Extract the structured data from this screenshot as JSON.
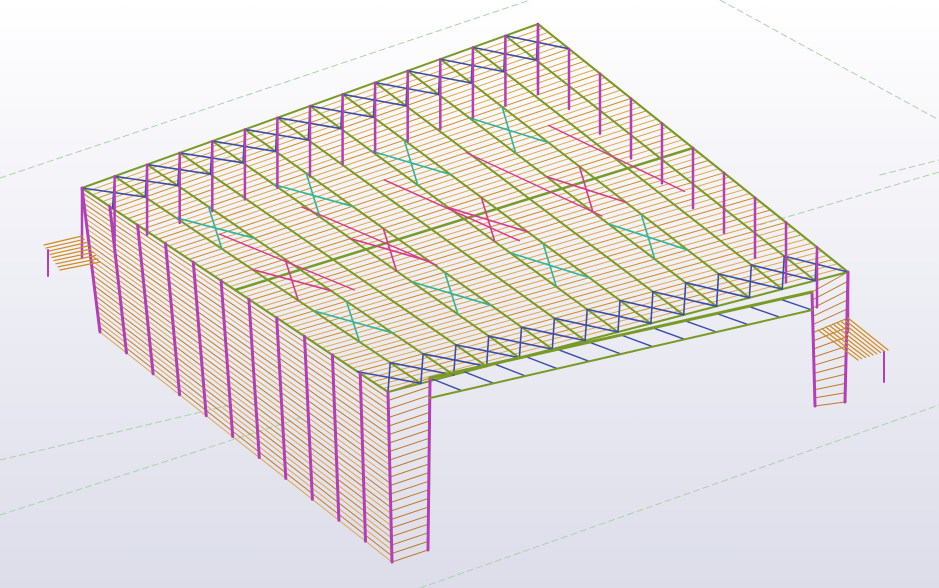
{
  "view": {
    "type": "3d-model-viewport",
    "background_top": "#ffffff",
    "background_bottom": "#dcdde9"
  },
  "colors": {
    "grid_line": "#a9d3a9",
    "purlin": "#d28a1e",
    "purlin_light": "#e0a64a",
    "rafter": "#7a9a26",
    "column": "#b23fb8",
    "bracing_blue": "#3a4ea8",
    "bracing_teal": "#2fb59a",
    "bracing_magenta": "#d63a8c",
    "girt": "#c07a2a"
  }
}
